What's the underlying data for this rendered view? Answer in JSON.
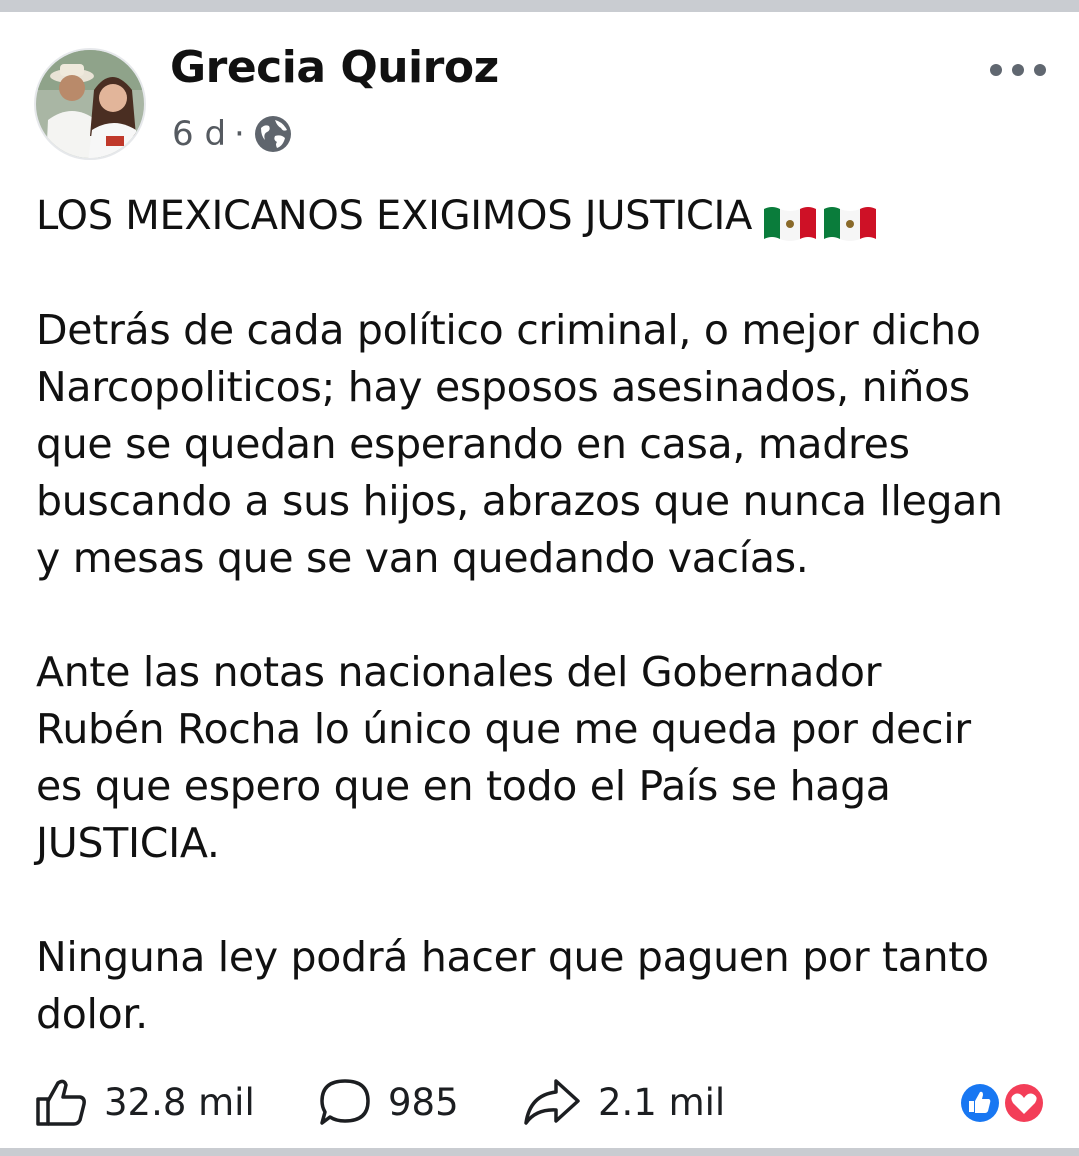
{
  "post": {
    "author": "Grecia Quiroz",
    "time": "6 d",
    "separator": "·",
    "privacy_icon": "globe-icon",
    "headline": "LOS MEXICANOS EXIGIMOS JUSTICIA",
    "headline_emoji": [
      "mexico-flag-icon",
      "mexico-flag-icon"
    ],
    "paragraphs": [
      "Detrás de cada político criminal, o mejor dicho\nNarcopoliticos; hay esposos asesinados, niños\nque se quedan esperando en casa, madres\nbuscando a sus hijos, abrazos que nunca llegan\ny mesas que se van quedando vacías.",
      "Ante las notas nacionales del Gobernador\nRubén Rocha lo único que me queda por decir\nes que espero que en todo el País se haga\nJUSTICIA.",
      "Ninguna ley podrá hacer que paguen por tanto\ndolor."
    ]
  },
  "actions": {
    "likes": "32.8 mil",
    "comments": "985",
    "shares": "2.1 mil"
  },
  "colors": {
    "divider": "#c9ccd1",
    "like_blue": "#1877f2",
    "love_red": "#f33e58",
    "text": "#111111",
    "meta": "#555a60"
  }
}
